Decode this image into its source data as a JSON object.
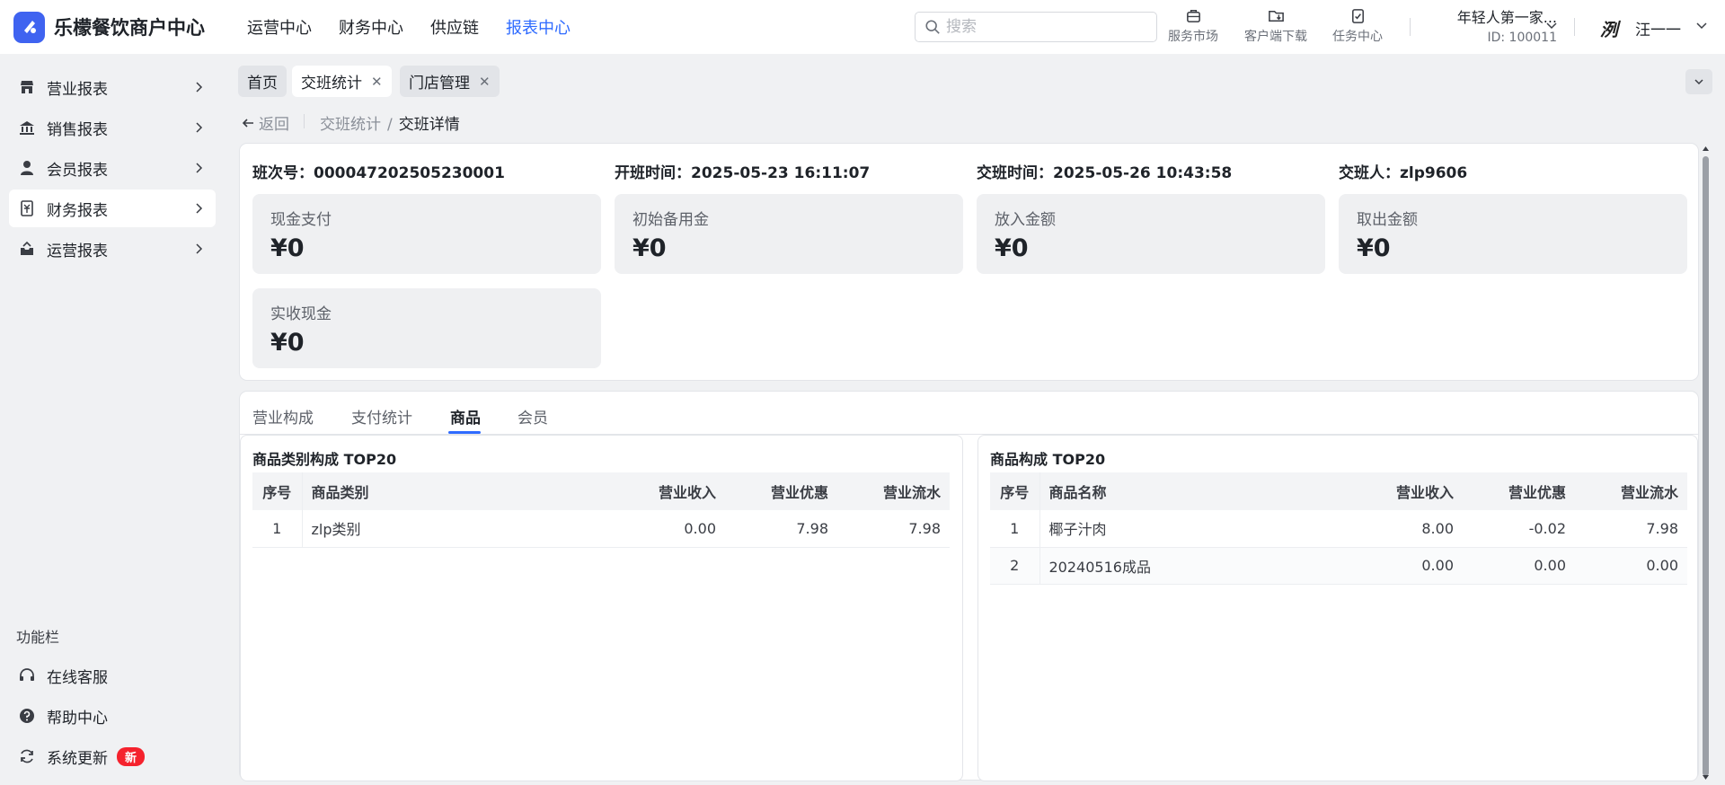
{
  "app": {
    "brand_name": "乐檬餐饮商户中心",
    "brand_color": "#3f63f0",
    "accent_color": "#2f6bff"
  },
  "header": {
    "nav": [
      {
        "label": "运营中心"
      },
      {
        "label": "财务中心"
      },
      {
        "label": "供应链"
      },
      {
        "label": "报表中心",
        "active": true
      }
    ],
    "search": {
      "placeholder": "搜索",
      "value": ""
    },
    "tools": [
      {
        "label": "服务市场",
        "icon": "briefcase-icon"
      },
      {
        "label": "客户端下载",
        "icon": "download-folder-icon"
      },
      {
        "label": "任务中心",
        "icon": "clipboard-check-icon"
      }
    ],
    "store": {
      "name": "年轻人第一家...",
      "id": "ID: 100011"
    },
    "user": {
      "avatar_text": "洌",
      "name": "汪一一"
    }
  },
  "sidebar": {
    "items": [
      {
        "label": "营业报表",
        "icon": "store-icon"
      },
      {
        "label": "销售报表",
        "icon": "bank-icon"
      },
      {
        "label": "会员报表",
        "icon": "user-icon"
      },
      {
        "label": "财务报表",
        "icon": "receipt-icon",
        "active": true
      },
      {
        "label": "运营报表",
        "icon": "inbox-icon"
      }
    ],
    "func_title": "功能栏",
    "func_items": [
      {
        "label": "在线客服",
        "icon": "headset-icon"
      },
      {
        "label": "帮助中心",
        "icon": "help-icon"
      },
      {
        "label": "系统更新",
        "icon": "refresh-icon",
        "badge": "新"
      }
    ]
  },
  "tabs": [
    {
      "label": "首页",
      "closable": false
    },
    {
      "label": "交班统计",
      "closable": true,
      "active": true
    },
    {
      "label": "门店管理",
      "closable": true
    }
  ],
  "breadcrumb": {
    "back": "返回",
    "prev": "交班统计",
    "current": "交班详情"
  },
  "shift_info": {
    "shift_no": "班次号：000047202505230001",
    "start_time": "开班时间：2025-05-23 16:11:07",
    "handover_time": "交班时间：2025-05-26 10:43:58",
    "handover_person": "交班人：zlp9606"
  },
  "stats": [
    {
      "label": "现金支付",
      "value": "¥0"
    },
    {
      "label": "初始备用金",
      "value": "¥0"
    },
    {
      "label": "放入金额",
      "value": "¥0"
    },
    {
      "label": "取出金额",
      "value": "¥0"
    },
    {
      "label": "实收现金",
      "value": "¥0"
    }
  ],
  "content_tabs": [
    {
      "label": "营业构成"
    },
    {
      "label": "支付统计"
    },
    {
      "label": "商品",
      "active": true
    },
    {
      "label": "会员"
    }
  ],
  "category_panel": {
    "title": "商品类别构成 TOP20",
    "columns": [
      "序号",
      "商品类别",
      "营业收入",
      "营业优惠",
      "营业流水"
    ],
    "rows": [
      [
        "1",
        "zlp类别",
        "0.00",
        "7.98",
        "7.98"
      ]
    ]
  },
  "product_panel": {
    "title": "商品构成 TOP20",
    "columns": [
      "序号",
      "商品名称",
      "营业收入",
      "营业优惠",
      "营业流水"
    ],
    "rows": [
      [
        "1",
        "椰子汁肉",
        "8.00",
        "-0.02",
        "7.98"
      ],
      [
        "2",
        "20240516成品",
        "0.00",
        "0.00",
        "0.00"
      ]
    ]
  }
}
